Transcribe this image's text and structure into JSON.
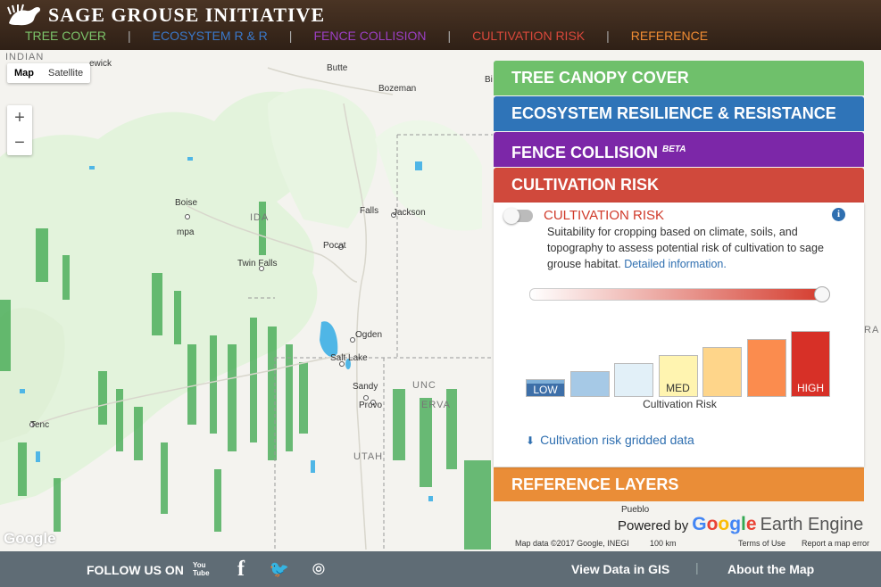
{
  "app": {
    "title": "SAGE GROUSE INITIATIVE"
  },
  "nav": [
    {
      "label": "TREE COVER",
      "color": "#7cc46a"
    },
    {
      "label": "ECOSYSTEM R & R",
      "color": "#3a78c9"
    },
    {
      "label": "FENCE COLLISION",
      "color": "#9b3fc2"
    },
    {
      "label": "CULTIVATION RISK",
      "color": "#d9483b"
    },
    {
      "label": "REFERENCE",
      "color": "#f08c33"
    }
  ],
  "map": {
    "type_buttons": [
      "Map",
      "Satellite"
    ],
    "zoom_in": "+",
    "zoom_out": "−",
    "labels": [
      "INDIAN",
      "ewick",
      "Butte",
      "Bozeman",
      "Bi",
      "Boise",
      "mpa",
      "IDA",
      "Falls",
      "Jackson",
      "Pocat",
      "Twin Falls",
      "Ogden",
      "Salt Lake",
      "Sandy",
      "Provo",
      "Tenc",
      "UTAH",
      "Pueblo",
      "RA",
      "UNC",
      "ERVA"
    ],
    "watermark": "Google",
    "attribution": {
      "data": "Map data ©2017 Google, INEGI",
      "scale": "100 km",
      "terms": "Terms of Use",
      "report": "Report a map error"
    },
    "powered_by": "Powered by",
    "google": "Google",
    "earth_engine": "Earth Engine"
  },
  "panel": {
    "sections": [
      {
        "label": "TREE CANOPY COVER",
        "color": "#6fc06b"
      },
      {
        "label": "ECOSYSTEM RESILIENCE & RESISTANCE",
        "color": "#2f74b8"
      },
      {
        "label": "FENCE COLLISION",
        "sup": "BETA",
        "color": "#7c27a8"
      },
      {
        "label": "CULTIVATION RISK",
        "color": "#d0493c"
      }
    ],
    "layer": {
      "title": "CULTIVATION RISK",
      "info_icon": "i",
      "enabled": false,
      "description": "Suitability for cropping based on climate, soils, and topography to assess potential risk of cultivation to sage grouse habitat.",
      "link": "Detailed information.",
      "opacity": 1.0,
      "legend": {
        "xlabel": "Cultivation Risk",
        "classes": [
          {
            "label": "LOW",
            "color": "#7fb0d8",
            "level": 1
          },
          {
            "label": "",
            "color": "#a6c9e6",
            "level": 2
          },
          {
            "label": "",
            "color": "#e2f0f8",
            "level": 3
          },
          {
            "label": "MED",
            "color": "#fff4b0",
            "level": 4
          },
          {
            "label": "",
            "color": "#fed58a",
            "level": 5
          },
          {
            "label": "",
            "color": "#fb8c4e",
            "level": 6
          },
          {
            "label": "HIGH",
            "color": "#d73027",
            "level": 7
          }
        ]
      },
      "download": "Cultivation risk gridded data"
    },
    "reference": {
      "label": "REFERENCE LAYERS",
      "color": "#ea8d37"
    }
  },
  "footer": {
    "follow": "FOLLOW US ON",
    "social": [
      "youtube-icon",
      "facebook-icon",
      "twitter-icon",
      "rss-icon"
    ],
    "youtube_text": "You Tube",
    "facebook_text": "f",
    "twitter_text": "🐦",
    "rss_text": "⦾",
    "links": [
      "View Data in GIS",
      "About the Map"
    ],
    "separator": "|"
  },
  "separators": "|"
}
